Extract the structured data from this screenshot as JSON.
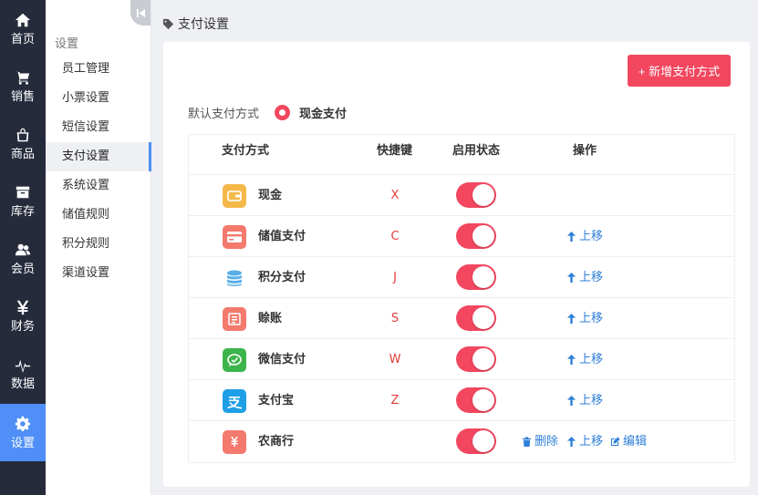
{
  "nav": {
    "items": [
      {
        "label": "首页",
        "icon": "home-icon"
      },
      {
        "label": "销售",
        "icon": "cart-icon"
      },
      {
        "label": "商品",
        "icon": "bag-icon"
      },
      {
        "label": "库存",
        "icon": "box-icon"
      },
      {
        "label": "会员",
        "icon": "users-icon"
      },
      {
        "label": "财务",
        "icon": "yen-icon"
      },
      {
        "label": "数据",
        "icon": "pulse-icon"
      },
      {
        "label": "设置",
        "icon": "gear-icon",
        "active": true
      }
    ]
  },
  "submenu": {
    "title": "设置",
    "items": [
      {
        "label": "员工管理"
      },
      {
        "label": "小票设置"
      },
      {
        "label": "短信设置"
      },
      {
        "label": "支付设置",
        "active": true
      },
      {
        "label": "系统设置"
      },
      {
        "label": "储值规则"
      },
      {
        "label": "积分规则"
      },
      {
        "label": "渠道设置"
      }
    ]
  },
  "breadcrumb": "支付设置",
  "add_button": "+ 新增支付方式",
  "default_payment": {
    "label": "默认支付方式",
    "value": "现金支付"
  },
  "table": {
    "headers": {
      "method": "支付方式",
      "hotkey": "快捷键",
      "status": "启用状态",
      "action": "操作"
    },
    "rows": [
      {
        "name": "现金",
        "hotkey": "X",
        "enabled": true,
        "icon": "wallet-icon",
        "color": "#f5b94a",
        "actions": []
      },
      {
        "name": "储值支付",
        "hotkey": "C",
        "enabled": true,
        "icon": "card-icon",
        "color": "#f47a6e",
        "actions": [
          "up"
        ]
      },
      {
        "name": "积分支付",
        "hotkey": "J",
        "enabled": true,
        "icon": "coins-icon",
        "color": "#5aaee8",
        "actions": [
          "up"
        ]
      },
      {
        "name": "赊账",
        "hotkey": "S",
        "enabled": true,
        "icon": "credit-icon",
        "color": "#f47a6e",
        "actions": [
          "up"
        ]
      },
      {
        "name": "微信支付",
        "hotkey": "W",
        "enabled": true,
        "icon": "wechat-icon",
        "color": "#3bb44a",
        "actions": [
          "up"
        ]
      },
      {
        "name": "支付宝",
        "hotkey": "Z",
        "enabled": true,
        "icon": "alipay-icon",
        "color": "#1f9fe6",
        "actions": [
          "up"
        ]
      },
      {
        "name": "农商行",
        "hotkey": "",
        "enabled": true,
        "icon": "yen-card-icon",
        "color": "#f47a6e",
        "actions": [
          "delete",
          "up",
          "edit"
        ]
      }
    ],
    "action_labels": {
      "up": "上移",
      "delete": "删除",
      "edit": "编辑"
    }
  },
  "colors": {
    "nav_bg": "#262b3c",
    "nav_active": "#4f8ff7",
    "accent": "#f2475f",
    "link": "#2f7fd8",
    "hotkey": "#e23b3b"
  }
}
